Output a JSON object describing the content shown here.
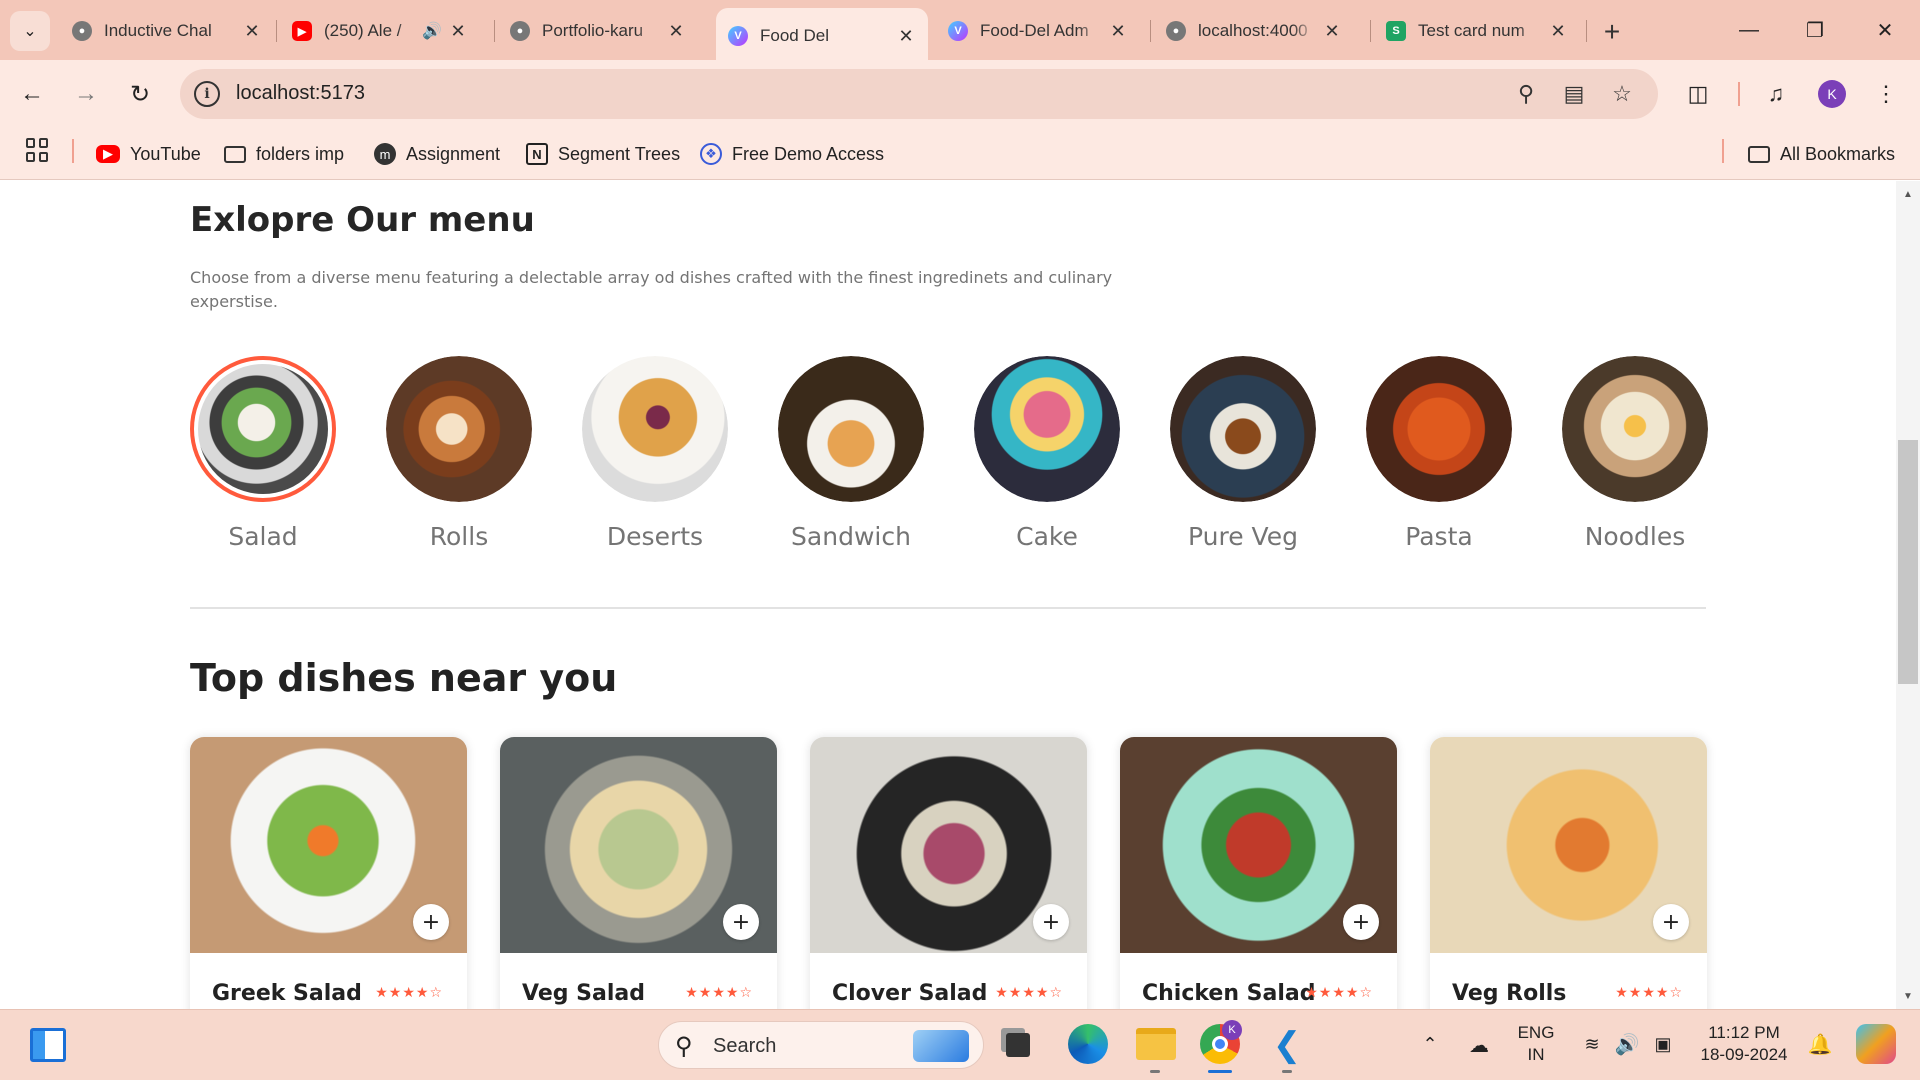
{
  "browser": {
    "tabs": [
      {
        "title": "Inductive Chal",
        "favicon": "globe-icon"
      },
      {
        "title": "(250) Ale /",
        "favicon": "youtube-icon",
        "audio": "speaker-icon"
      },
      {
        "title": "Portfolio-karu",
        "favicon": "globe-icon"
      },
      {
        "title": "Food Del",
        "favicon": "vite-icon",
        "active": true
      },
      {
        "title": "Food-Del Adm",
        "favicon": "vite-icon"
      },
      {
        "title": "localhost:4000",
        "favicon": "globe-icon"
      },
      {
        "title": "Test card num",
        "favicon": "sheets-icon"
      }
    ],
    "url": "localhost:5173",
    "profile_initial": "K",
    "bookmarks": [
      {
        "label": "YouTube",
        "icon": "youtube-icon"
      },
      {
        "label": "folders imp",
        "icon": "folder-icon"
      },
      {
        "label": "Assignment",
        "icon": "m-logo-icon"
      },
      {
        "label": "Segment Trees",
        "icon": "notion-icon"
      },
      {
        "label": "Free Demo Access",
        "icon": "globe-blue-icon"
      }
    ],
    "all_bookmarks_label": "All Bookmarks"
  },
  "page": {
    "menu_title": "Exlopre Our menu",
    "menu_description": "Choose from a diverse menu featuring a delectable array od dishes crafted with the finest ingredinets and culinary experstise.",
    "categories": [
      {
        "label": "Salad",
        "active": true
      },
      {
        "label": "Rolls"
      },
      {
        "label": "Deserts"
      },
      {
        "label": "Sandwich"
      },
      {
        "label": "Cake"
      },
      {
        "label": "Pure Veg"
      },
      {
        "label": "Pasta"
      },
      {
        "label": "Noodles"
      }
    ],
    "dishes_title": "Top dishes near you",
    "dishes": [
      {
        "name": "Greek Salad",
        "rating": 4,
        "add": "+"
      },
      {
        "name": "Veg Salad",
        "rating": 4,
        "add": "+"
      },
      {
        "name": "Clover Salad",
        "rating": 4,
        "add": "+"
      },
      {
        "name": "Chicken Salad",
        "rating": 4,
        "add": "+"
      },
      {
        "name": "Veg Rolls",
        "rating": 4,
        "add": "+"
      }
    ],
    "accent_color": "#ff5a3c"
  },
  "taskbar": {
    "search_label": "Search",
    "language": "ENG",
    "region": "IN",
    "time": "11:12 PM",
    "date": "18-09-2024"
  }
}
